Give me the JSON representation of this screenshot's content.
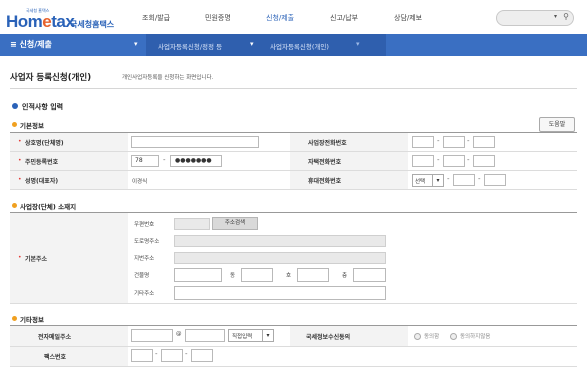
{
  "header": {
    "logo_tag": "국세청 홈택스",
    "logo_main_a": "Hom",
    "logo_main_b": "e",
    "logo_main_c": "tax",
    "logo_sub": "국세청홈택스",
    "nav": [
      "조회/발급",
      "민원증명",
      "신청/제출",
      "신고/납부",
      "상담/제보"
    ],
    "search_dropdown": "▾",
    "search_icon": "search-icon"
  },
  "bar": {
    "title": "≡  신청/제출",
    "crumb1": "사업자등록신청/정정 등",
    "crumb2": "사업자등록신청(개인)"
  },
  "page": {
    "title": "사업자 등록신청(개인)",
    "desc": "개인사업자등록을 신청하는 화면입니다."
  },
  "section_personal": {
    "title": "인적사항 입력"
  },
  "basic": {
    "title": "기본정보",
    "help_button": "도움말",
    "labels": {
      "trade_name": "상호명(단체명)",
      "rrn": "주민등록번호",
      "name": "성명(대표자)",
      "biz_phone": "사업장전화번호",
      "home_phone": "자택전화번호",
      "mobile": "휴대전화번호"
    },
    "rrn_front": "78",
    "rrn_back": "●●●●●●●",
    "name_value": "이경식",
    "mobile_select": "선택"
  },
  "address": {
    "title": "사업장(단체) 소재지",
    "label": "기본주소",
    "postcode": "우편번호",
    "search_btn": "주소검색",
    "road": "도로명주소",
    "jibun": "지번주소",
    "building": "건물명",
    "dong": "동",
    "ho": "호",
    "floor": "층",
    "other": "기타주소"
  },
  "etc": {
    "title": "기타정보",
    "email_label": "전자메일주소",
    "at": "@",
    "direct_input": "직접입력",
    "consent_label": "국세정보수신동의",
    "agree": "동의함",
    "disagree": "동의하지않음",
    "fax_label": "팩스번호"
  }
}
